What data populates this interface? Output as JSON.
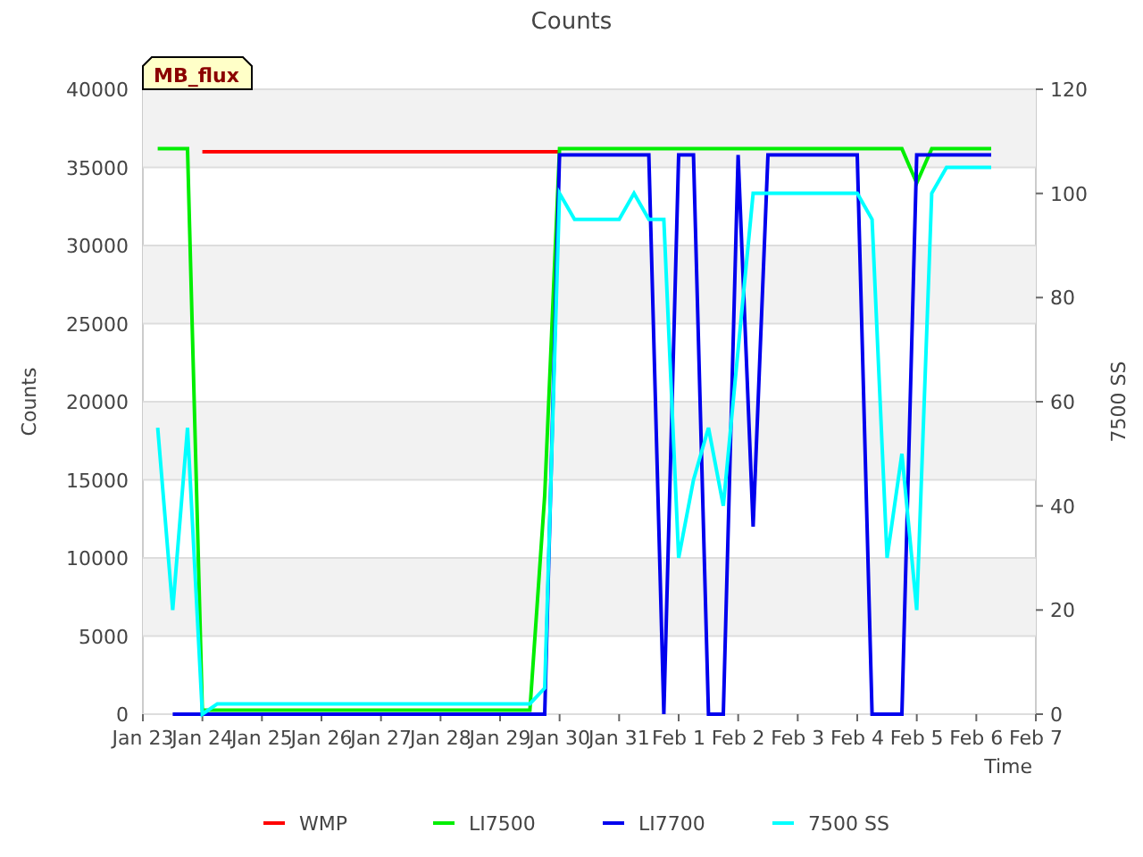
{
  "chart_data": {
    "type": "line",
    "title": "Counts",
    "xlabel": "Time",
    "ylabel": "Counts",
    "y2label": "7500 SS",
    "ylim": [
      0,
      40000
    ],
    "y2lim": [
      0,
      120
    ],
    "categories": [
      "Jan 23",
      null,
      null,
      null,
      "Jan 24",
      null,
      null,
      null,
      "Jan 25",
      null,
      null,
      null,
      "Jan 26",
      null,
      null,
      null,
      "Jan 27",
      null,
      null,
      null,
      "Jan 28",
      null,
      null,
      null,
      "Jan 29",
      null,
      null,
      null,
      "Jan 30",
      null,
      null,
      null,
      "Jan 31",
      null,
      null,
      null,
      "Feb 1",
      null,
      null,
      null,
      "Feb 2",
      null,
      null,
      null,
      "Feb 3",
      null,
      null,
      null,
      "Feb 4",
      null,
      null,
      null,
      "Feb 5",
      null,
      null,
      null,
      "Feb 6",
      null,
      null,
      null,
      "Feb 7"
    ],
    "yticks": [
      0,
      5000,
      10000,
      15000,
      20000,
      25000,
      30000,
      35000,
      40000
    ],
    "y2ticks": [
      0,
      20,
      40,
      60,
      80,
      100,
      120
    ],
    "series": [
      {
        "name": "WMP",
        "color": "#ff0000",
        "values": [
          null,
          null,
          null,
          null,
          36000,
          36000,
          36000,
          36000,
          36000,
          36000,
          36000,
          36000,
          36000,
          36000,
          36000,
          36000,
          36000,
          36000,
          36000,
          36000,
          36000,
          36000,
          36000,
          36000,
          36000,
          36000,
          36000,
          36000,
          36000,
          null,
          null,
          null,
          null,
          null,
          null,
          null,
          null,
          null,
          null,
          null,
          null,
          null,
          null,
          null,
          null,
          null,
          null,
          null,
          null,
          null,
          null,
          null,
          null,
          null,
          null,
          null,
          null,
          null,
          null,
          null,
          null
        ]
      },
      {
        "name": "LI7500",
        "color": "#00ee00",
        "values": [
          null,
          36200,
          36200,
          36200,
          250,
          250,
          250,
          250,
          250,
          250,
          250,
          250,
          250,
          250,
          250,
          250,
          250,
          250,
          250,
          250,
          250,
          250,
          250,
          250,
          250,
          250,
          250,
          14000,
          36200,
          36200,
          36200,
          36200,
          36200,
          36200,
          36200,
          36200,
          36200,
          36200,
          36200,
          36200,
          36200,
          36200,
          36200,
          36200,
          36200,
          36200,
          36200,
          36200,
          36200,
          36200,
          36200,
          36200,
          34000,
          36200,
          36200,
          36200,
          36200,
          36200,
          null,
          null,
          null
        ]
      },
      {
        "name": "LI7700",
        "color": "#0000ee",
        "values": [
          null,
          null,
          0,
          0,
          0,
          0,
          0,
          0,
          0,
          0,
          0,
          0,
          0,
          0,
          0,
          0,
          0,
          0,
          0,
          0,
          0,
          0,
          0,
          0,
          0,
          0,
          0,
          0,
          35800,
          35800,
          35800,
          35800,
          35800,
          35800,
          35800,
          0,
          35800,
          35800,
          0,
          0,
          35800,
          12000,
          35800,
          35800,
          35800,
          35800,
          35800,
          35800,
          35800,
          0,
          0,
          0,
          35800,
          35800,
          35800,
          35800,
          35800,
          35800,
          null,
          null,
          null
        ]
      },
      {
        "name": "7500 SS",
        "color": "#00ffff",
        "axis": "y2",
        "values": [
          null,
          55,
          20,
          55,
          0,
          2,
          2,
          2,
          2,
          2,
          2,
          2,
          2,
          2,
          2,
          2,
          2,
          2,
          2,
          2,
          2,
          2,
          2,
          2,
          2,
          2,
          2,
          5,
          100,
          95,
          95,
          95,
          95,
          100,
          95,
          95,
          30,
          45,
          55,
          40,
          70,
          100,
          100,
          100,
          100,
          100,
          100,
          100,
          100,
          95,
          30,
          50,
          20,
          100,
          105,
          105,
          105,
          105,
          null,
          null,
          null
        ]
      }
    ],
    "annotations": [
      {
        "text": "MB_flux"
      }
    ],
    "grid": true,
    "legend": true
  }
}
